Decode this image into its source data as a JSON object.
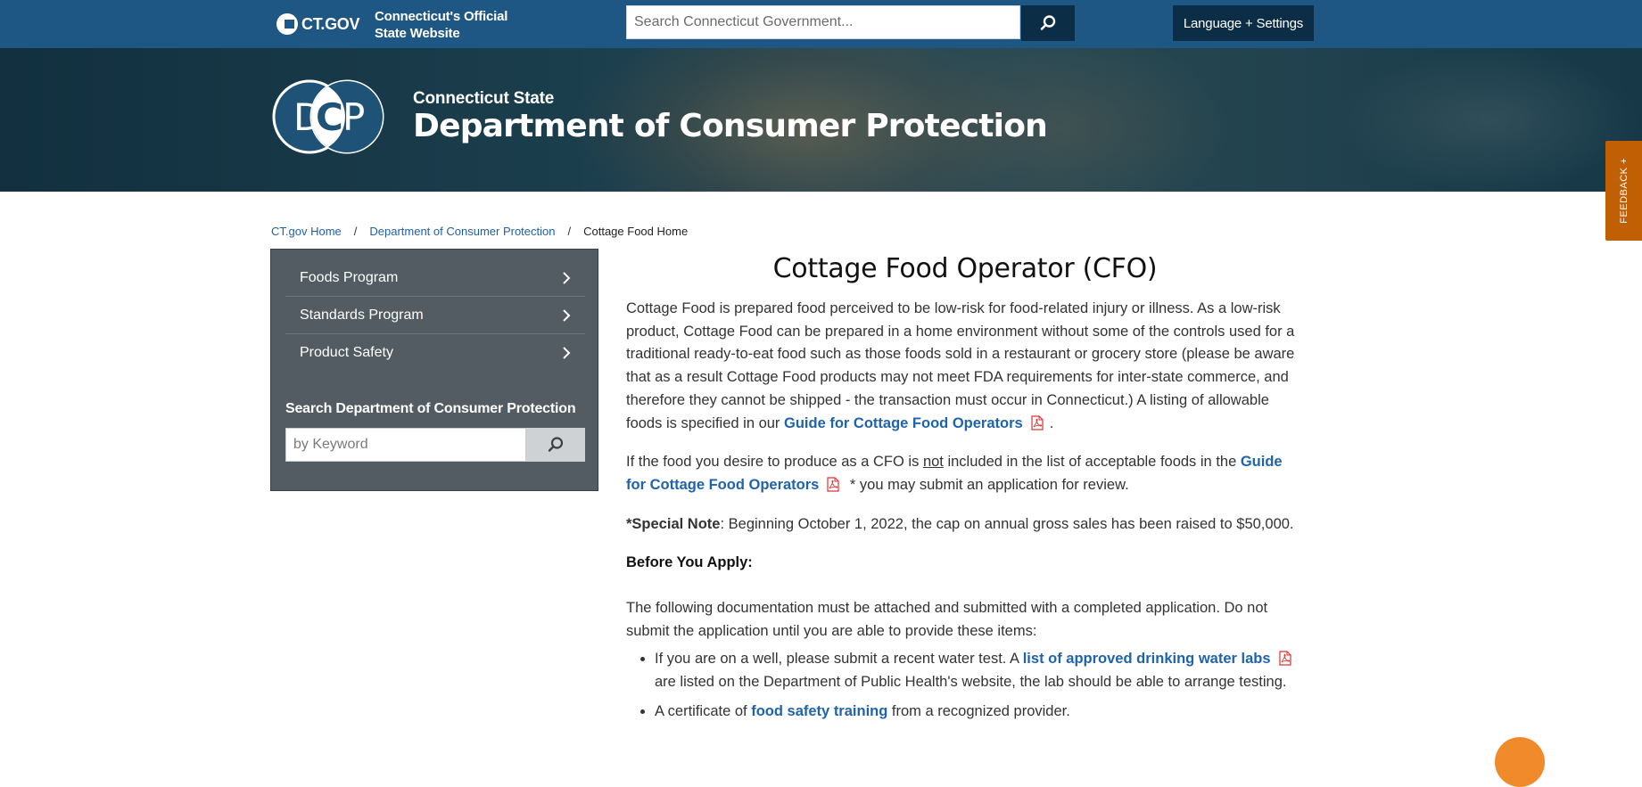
{
  "topbar": {
    "logo_text": "CT.GOV",
    "official_line1": "Connecticut's Official",
    "official_line2": "State Website",
    "search_placeholder": "Search Connecticut Government...",
    "language_button": "Language + Settings"
  },
  "banner": {
    "logo_letters": [
      "D",
      "C",
      "P"
    ],
    "subtitle": "Connecticut State",
    "title": "Department of Consumer Protection"
  },
  "feedback": {
    "label": "FEEDBACK +"
  },
  "breadcrumb": {
    "items": [
      {
        "label": "CT.gov Home"
      },
      {
        "label": "Department of Consumer Protection"
      },
      {
        "label": "Cottage Food Home"
      }
    ],
    "separator": "/"
  },
  "sidebar": {
    "items": [
      {
        "label": "Foods Program"
      },
      {
        "label": "Standards Program"
      },
      {
        "label": "Product Safety"
      }
    ],
    "search_title": "Search Department of Consumer Protection",
    "search_placeholder": "by Keyword"
  },
  "main": {
    "title": "Cottage Food Operator (CFO)",
    "p1_text": "Cottage Food is prepared food perceived to be low-risk for food-related injury or illness.   As a low-risk product, Cottage Food can be prepared in a home environment without some of the controls used for a traditional ready-to-eat food such as those foods sold in a restaurant or grocery store (please be aware that as a result Cottage Food products may not meet FDA requirements for inter-state commerce, and therefore they cannot be shipped - the transaction must occur in Connecticut.)   A listing of allowable foods is specified in our ",
    "p1_link": "Guide for Cottage Food Operators",
    "p1_end": ".",
    "p2_a": "If the food you desire to produce as a CFO is ",
    "p2_not": "not",
    "p2_b": " included in the list of acceptable foods in the ",
    "p2_link": "Guide for Cottage Food Operators",
    "p2_end": " * you may submit an application for review.",
    "note_label": "*Special Note",
    "note_text": ": Beginning October 1, 2022, the cap on annual gross sales has been raised to $50,000.",
    "before_apply": "Before You Apply:",
    "p4": "The following documentation must be attached and submitted with a completed application.  Do not submit the application until you are able to provide these items:",
    "li1_a": "If you are on a well, please submit a recent water test.  A ",
    "li1_link": "list of approved drinking water labs",
    "li1_b": " are listed on the Department of Public Health's website, the lab should be able to arrange testing.",
    "li2_a": "A certificate of ",
    "li2_link": "food safety training",
    "li2_b": " from a recognized provider."
  },
  "colors": {
    "topbar": "#1e5784",
    "dark_button": "#0b2e46",
    "sidebar": "#535c62",
    "link": "#1f63ad",
    "feedback": "#c15f05",
    "logo_blue": "#1e5276",
    "logo_orange": "#f18a2a"
  }
}
